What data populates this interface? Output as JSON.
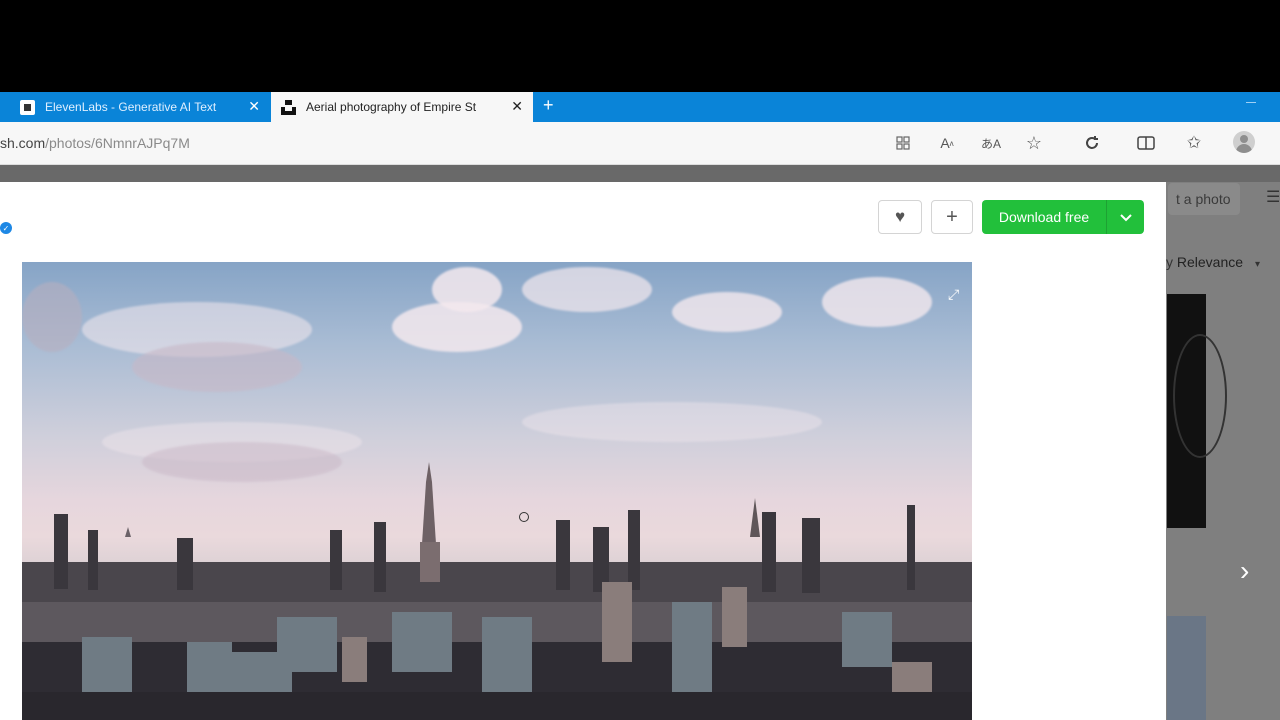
{
  "tabs": [
    {
      "title": "ElevenLabs - Generative AI Text",
      "active": false
    },
    {
      "title": "Aerial photography of Empire St",
      "active": true
    }
  ],
  "address": {
    "domain": "sh.com",
    "path": "/photos/6NmnrAJPq7M"
  },
  "toolbar_icons": [
    "apps-icon",
    "read-aloud-icon",
    "translate-icon",
    "favorite-star-icon",
    "refresh-icon",
    "split-screen-icon",
    "favorites-icon",
    "profile-icon"
  ],
  "modal": {
    "download_label": "Download free"
  },
  "background": {
    "submit_label": "t a photo",
    "sort_prefix": "y ",
    "sort_value": "Relevance"
  },
  "photo": {
    "alt": "Aerial photography of Empire State Building"
  },
  "colors": {
    "tab_bar": "#0a84d8",
    "download": "#22c03b",
    "verified": "#1e88e5"
  }
}
